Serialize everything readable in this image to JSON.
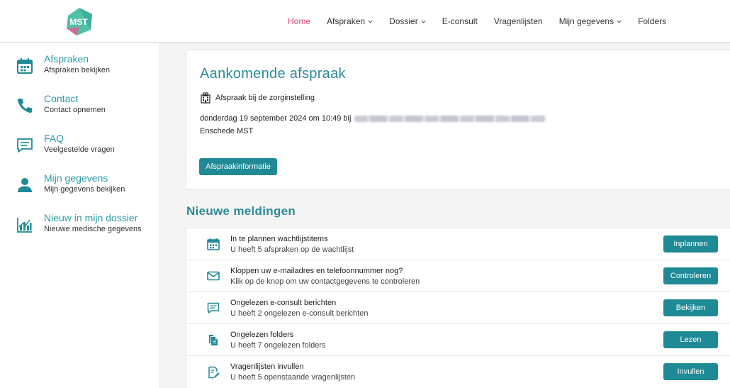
{
  "colors": {
    "accent": "#1f8a96",
    "active_nav": "#e0457b",
    "logo": "#4fc1a8"
  },
  "header": {
    "logo_text": "MST",
    "nav": [
      {
        "label": "Home",
        "active": true,
        "dropdown": false
      },
      {
        "label": "Afspraken",
        "active": false,
        "dropdown": true
      },
      {
        "label": "Dossier",
        "active": false,
        "dropdown": true
      },
      {
        "label": "E-consult",
        "active": false,
        "dropdown": false
      },
      {
        "label": "Vragenlijsten",
        "active": false,
        "dropdown": false
      },
      {
        "label": "Mijn gegevens",
        "active": false,
        "dropdown": true
      },
      {
        "label": "Folders",
        "active": false,
        "dropdown": false
      }
    ]
  },
  "sidebar": {
    "items": [
      {
        "title": "Afspraken",
        "subtitle": "Afspraken bekijken",
        "icon": "calendar-icon"
      },
      {
        "title": "Contact",
        "subtitle": "Contact opnemen",
        "icon": "phone-icon"
      },
      {
        "title": "FAQ",
        "subtitle": "Veelgestelde vragen",
        "icon": "chat-icon"
      },
      {
        "title": "Mijn gegevens",
        "subtitle": "Mijn gegevens bekijken",
        "icon": "person-icon"
      },
      {
        "title": "Nieuw in mijn dossier",
        "subtitle": "Nieuwe medische gegevens",
        "icon": "chart-icon"
      }
    ]
  },
  "appointment": {
    "title": "Aankomende afspraak",
    "type": "Afspraak bij de zorginstelling",
    "datetime": "donderdag 19 september 2024 om 10:49 bij",
    "location": "Enschede MST",
    "button": "Afspraakinformatie"
  },
  "notifications": {
    "title": "Nieuwe meldingen",
    "items": [
      {
        "title": "In te plannen wachtlijstitems",
        "subtitle": "U heeft 5 afspraken op de wachtlijst",
        "button": "Inplannen",
        "icon": "calendar-icon"
      },
      {
        "title": "Kloppen uw e-mailadres en telefoonnummer nog?",
        "subtitle": "Klik op de knop om uw contactgegevens te controleren",
        "button": "Controleren",
        "icon": "envelope-icon"
      },
      {
        "title": "Ongelezen e-consult berichten",
        "subtitle": "U heeft 2 ongelezen e-consult berichten",
        "button": "Bekijken",
        "icon": "chat-icon"
      },
      {
        "title": "Ongelezen folders",
        "subtitle": "U heeft 7 ongelezen folders",
        "button": "Lezen",
        "icon": "documents-icon"
      },
      {
        "title": "Vragenlijsten invullen",
        "subtitle": "U heeft 5 openstaande vragenlijsten",
        "button": "Invullen",
        "icon": "form-edit-icon"
      }
    ]
  }
}
